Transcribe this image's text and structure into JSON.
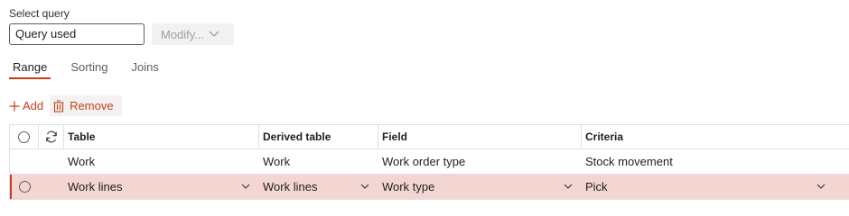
{
  "query": {
    "label": "Select query",
    "value": "Query used",
    "modify_label": "Modify..."
  },
  "tabs": [
    {
      "label": "Range",
      "active": true
    },
    {
      "label": "Sorting",
      "active": false
    },
    {
      "label": "Joins",
      "active": false
    }
  ],
  "actions": {
    "add_label": "Add",
    "remove_label": "Remove"
  },
  "grid": {
    "columns": [
      "Table",
      "Derived table",
      "Field",
      "Criteria"
    ],
    "rows": [
      {
        "table": "Work",
        "derived": "Work",
        "field": "Work order type",
        "criteria": "Stock movement",
        "selected": false
      },
      {
        "table": "Work lines",
        "derived": "Work lines",
        "field": "Work type",
        "criteria": "Pick",
        "selected": true
      }
    ]
  },
  "colors": {
    "accent": "#c43e1c",
    "selected_row": "#f3d6d2",
    "disabled_text": "#a19f9d"
  }
}
